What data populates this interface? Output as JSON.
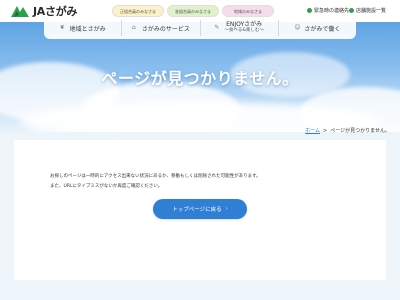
{
  "header": {
    "logo_text": "JAさがみ",
    "pills": [
      "正組合員のみなさま",
      "准組合員のみなさま",
      "地域のみなさま"
    ],
    "utility": [
      "緊急時の連絡先",
      "店舗施設一覧"
    ]
  },
  "nav": {
    "items": [
      {
        "label": "地域とさがみ",
        "icon": "leaf-icon"
      },
      {
        "label": "さがみのサービス",
        "icon": "house-icon"
      },
      {
        "label": "ENJOYさがみ",
        "sub": "〜食べる&楽しむ〜",
        "icon": "utensils-icon"
      },
      {
        "label": "さがみで働く",
        "icon": "people-icon"
      }
    ]
  },
  "hero": {
    "title": "ページが見つかりません。"
  },
  "breadcrumb": {
    "home": "ホーム",
    "separator": ">",
    "current": "ページが見つかりません。"
  },
  "content": {
    "message_1": "お探しのページは一時的にアクセス出来ない状況にあるか、移動もしくは削除された可能性があります。",
    "message_2": "また、URLにタイプミスがないか再度ご確認ください。",
    "button_label": "トップページに戻る",
    "button_arrow": "›"
  },
  "colors": {
    "brand_green": "#2e9f4a",
    "button_blue": "#2f7fd4",
    "sky": "#5fa3e4"
  }
}
